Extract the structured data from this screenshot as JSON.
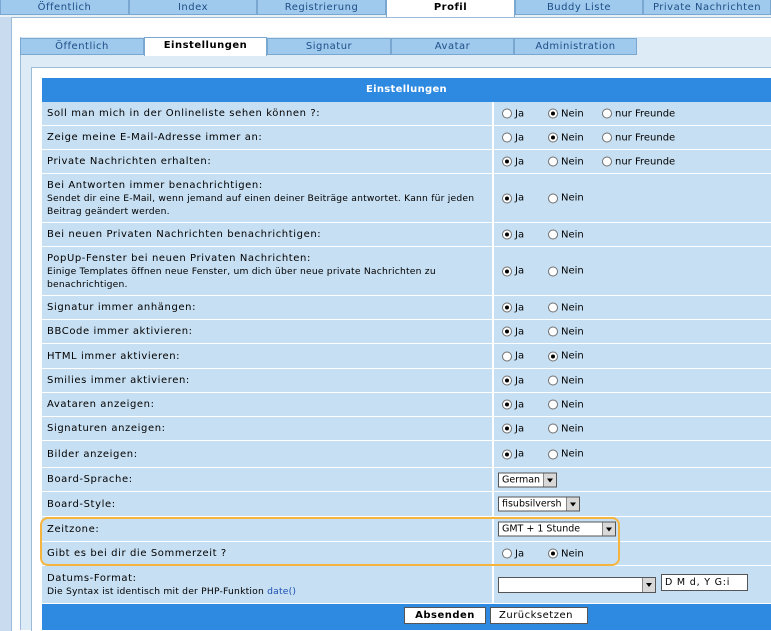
{
  "top_tabs": [
    "Öffentlich",
    "Index",
    "Registrierung",
    "Profil",
    "Buddy Liste",
    "Private Nachrichten"
  ],
  "sub_tabs": [
    "Öffentlich",
    "Einstellungen",
    "Signatur",
    "Avatar",
    "Administration"
  ],
  "form": {
    "title": "Einstellungen",
    "rows": [
      {
        "label": "Soll man mich in der Onlineliste sehen können ?:",
        "options": [
          "Ja",
          "Nein",
          "nur Freunde"
        ],
        "selected": "Nein"
      },
      {
        "label": "Zeige meine E-Mail-Adresse immer an:",
        "options": [
          "Ja",
          "Nein",
          "nur Freunde"
        ],
        "selected": "Nein"
      },
      {
        "label": "Private Nachrichten erhalten:",
        "options": [
          "Ja",
          "Nein",
          "nur Freunde"
        ],
        "selected": "Ja"
      },
      {
        "label": "Bei Antworten immer benachrichtigen:",
        "desc": "Sendet dir eine E-Mail, wenn jemand auf einen deiner Beiträge antwortet. Kann für jeden Beitrag geändert werden.",
        "options": [
          "Ja",
          "Nein"
        ],
        "selected": "Ja"
      },
      {
        "label": "Bei neuen Privaten Nachrichten benachrichtigen:",
        "options": [
          "Ja",
          "Nein"
        ],
        "selected": "Ja"
      },
      {
        "label": "PopUp-Fenster bei neuen Privaten Nachrichten:",
        "desc": "Einige Templates öffnen neue Fenster, um dich über neue private Nachrichten zu benachrichtigen.",
        "options": [
          "Ja",
          "Nein"
        ],
        "selected": "Ja"
      },
      {
        "label": "Signatur immer anhängen:",
        "options": [
          "Ja",
          "Nein"
        ],
        "selected": "Ja"
      },
      {
        "label": "BBCode immer aktivieren:",
        "options": [
          "Ja",
          "Nein"
        ],
        "selected": "Ja"
      },
      {
        "label": "HTML immer aktivieren:",
        "options": [
          "Ja",
          "Nein"
        ],
        "selected": "Nein"
      },
      {
        "label": "Smilies immer aktivieren:",
        "options": [
          "Ja",
          "Nein"
        ],
        "selected": "Ja"
      },
      {
        "label": "Avataren anzeigen:",
        "options": [
          "Ja",
          "Nein"
        ],
        "selected": "Ja"
      },
      {
        "label": "Signaturen anzeigen:",
        "options": [
          "Ja",
          "Nein"
        ],
        "selected": "Ja"
      },
      {
        "label": "Bilder anzeigen:",
        "options": [
          "Ja",
          "Nein"
        ],
        "selected": "Ja"
      }
    ],
    "board_language": {
      "label": "Board-Sprache:",
      "value": "German"
    },
    "board_style": {
      "label": "Board-Style:",
      "value": "fisubsilversh"
    },
    "timezone": {
      "label": "Zeitzone:",
      "value": "GMT + 1 Stunde"
    },
    "dst": {
      "label": "Gibt es bei dir die Sommerzeit ?",
      "options": [
        "Ja",
        "Nein"
      ],
      "selected": "Nein"
    },
    "date_format": {
      "label": "Datums-Format:",
      "desc_prefix": "Die Syntax ist identisch mit der PHP-Funktion",
      "desc_link": "date()",
      "select_value": "",
      "input_value": "D M d, Y G:i"
    }
  },
  "buttons": {
    "submit": "Absenden",
    "reset": "Zurücksetzen"
  },
  "colors": {
    "header": "#2d8ae0",
    "row_bg": "#c7dff2",
    "highlight": "#f5b43d"
  }
}
